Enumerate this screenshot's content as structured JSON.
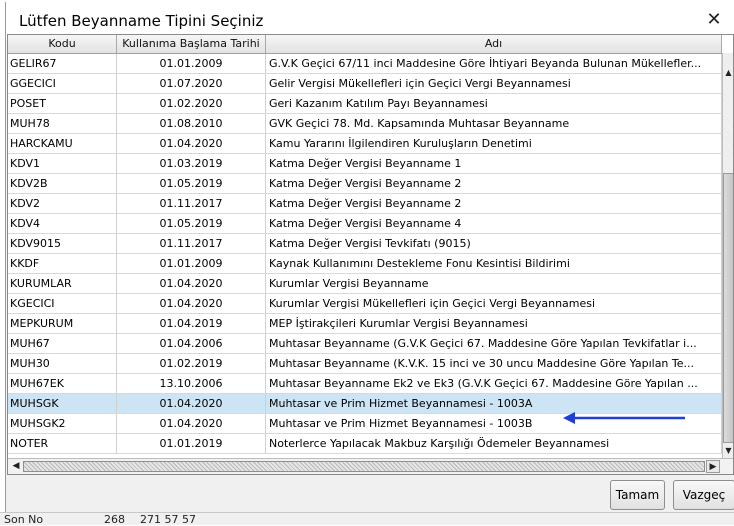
{
  "dialog": {
    "title": "Lütfen Beyanname Tipini Seçiniz",
    "close_glyph": "✕"
  },
  "table": {
    "headers": [
      "Kodu",
      "Kullanıma Başlama Tarihi",
      "Adı"
    ],
    "rows": [
      [
        "GELIR67",
        "01.01.2009",
        "G.V.K Geçici 67/11 inci Maddesine Göre İhtiyari Beyanda Bulunan Mükellefler..."
      ],
      [
        "GGECICI",
        "01.07.2020",
        "Gelir Vergisi Mükellefleri için Geçici Vergi Beyannamesi"
      ],
      [
        "POSET",
        "01.02.2020",
        "Geri Kazanım Katılım Payı Beyannamesi"
      ],
      [
        "MUH78",
        "01.08.2010",
        "GVK Geçici 78. Md. Kapsamında Muhtasar Beyanname"
      ],
      [
        "HARCKAMU",
        "01.04.2020",
        "Kamu Yararını İlgilendiren Kuruluşların Denetimi"
      ],
      [
        "KDV1",
        "01.03.2019",
        "Katma Değer Vergisi Beyanname 1"
      ],
      [
        "KDV2B",
        "01.05.2019",
        "Katma Değer Vergisi Beyanname 2"
      ],
      [
        "KDV2",
        "01.11.2017",
        "Katma Değer Vergisi Beyanname 2"
      ],
      [
        "KDV4",
        "01.05.2019",
        "Katma Değer Vergisi Beyanname 4"
      ],
      [
        "KDV9015",
        "01.11.2017",
        "Katma Değer Vergisi Tevkifatı (9015)"
      ],
      [
        "KKDF",
        "01.01.2009",
        "Kaynak Kullanımını Destekleme Fonu Kesintisi Bildirimi"
      ],
      [
        "KURUMLAR",
        "01.04.2020",
        "Kurumlar Vergisi Beyanname"
      ],
      [
        "KGECICI",
        "01.04.2020",
        "Kurumlar Vergisi Mükellefleri için Geçici Vergi Beyannamesi"
      ],
      [
        "MEPKURUM",
        "01.04.2019",
        "MEP İştirakçileri Kurumlar Vergisi Beyannamesi"
      ],
      [
        "MUH67",
        "01.04.2006",
        "Muhtasar Beyanname (G.V.K Geçici 67. Maddesine Göre Yapılan Tevkifatlar i..."
      ],
      [
        "MUH30",
        "01.02.2019",
        "Muhtasar Beyanname (K.V.K. 15 inci ve 30 uncu Maddesine Göre Yapılan Te..."
      ],
      [
        "MUH67EK",
        "13.10.2006",
        "Muhtasar Beyanname Ek2 ve Ek3 (G.V.K Geçici 67. Maddesine Göre Yapılan ..."
      ],
      [
        "MUHSGK",
        "01.04.2020",
        "Muhtasar ve Prim Hizmet Beyannamesi - 1003A"
      ],
      [
        "MUHSGK2",
        "01.04.2020",
        "Muhtasar ve Prim Hizmet Beyannamesi - 1003B"
      ],
      [
        "NOTER",
        "01.01.2019",
        "Noterlerce Yapılacak Makbuz Karşılığı Ödemeler Beyannamesi"
      ]
    ],
    "selected_row_code": "MUHSGK"
  },
  "buttons": {
    "ok": "Tamam",
    "cancel": "Vazgeç"
  },
  "background": {
    "bottom_texts": [
      "Son No",
      "268",
      "271 57 57"
    ]
  },
  "colors": {
    "selected_row": "#cce4f4",
    "arrow": "#1f3fd6"
  }
}
